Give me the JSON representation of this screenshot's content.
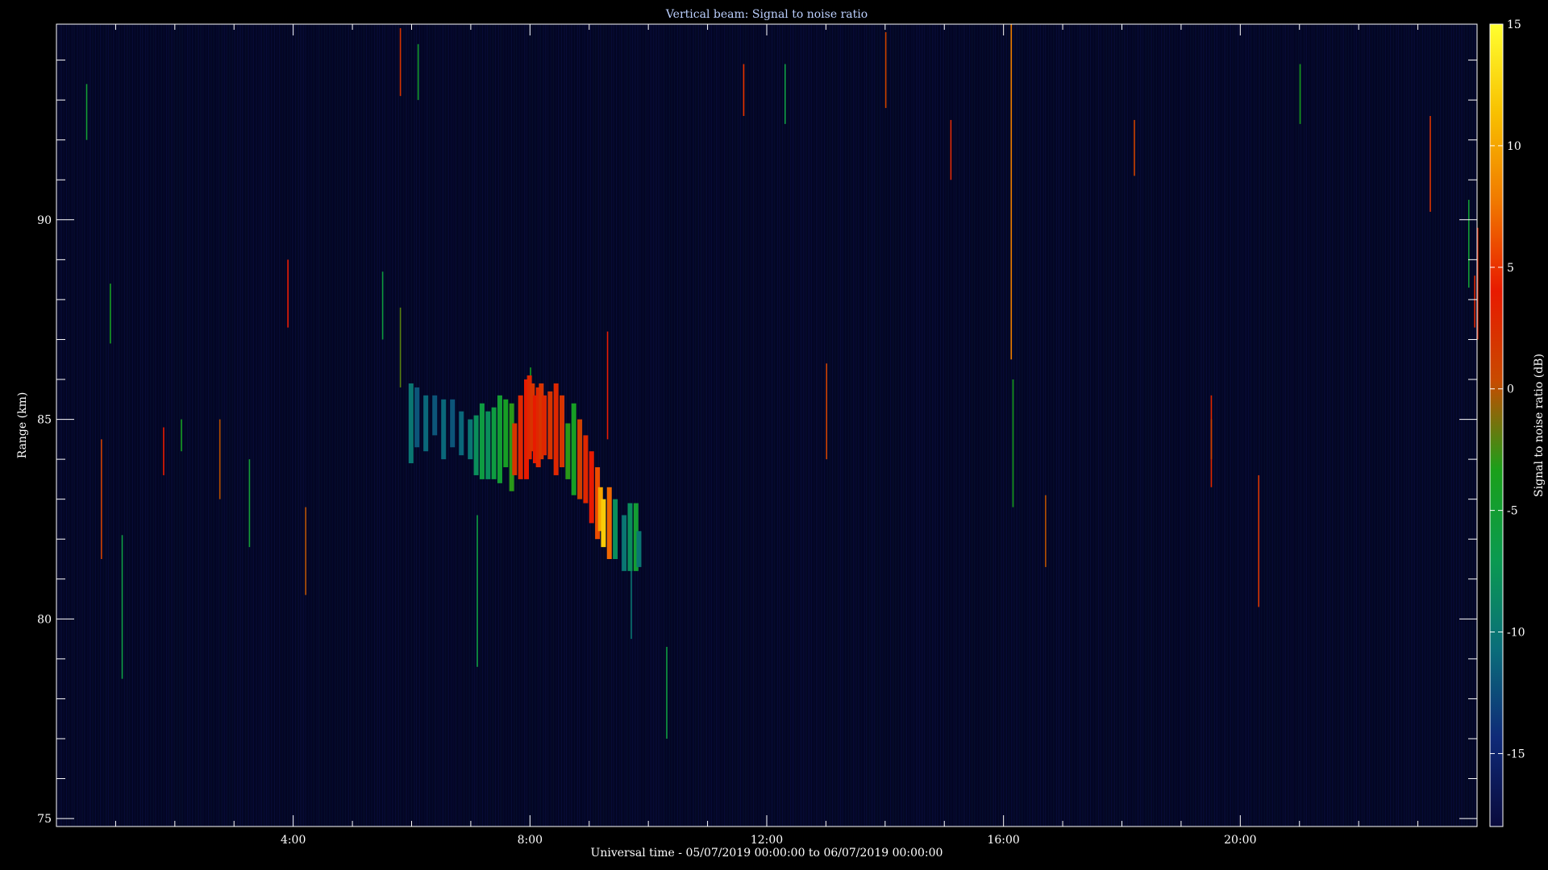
{
  "chart_data": {
    "type": "heatmap",
    "title": "Vertical beam: Signal to noise ratio",
    "xlabel": "Universal time - 05/07/2019 00:00:00 to 06/07/2019 00:00:00",
    "ylabel": "Range (km)",
    "colorbar_label": "Signal to noise ratio (dB)",
    "x_unit": "hours UT",
    "xlim": [
      0,
      24
    ],
    "ylim": [
      74.8,
      94.9
    ],
    "x_ticks": [
      4,
      8,
      12,
      16,
      20
    ],
    "x_tick_labels": [
      "4:00",
      "8:00",
      "12:00",
      "16:00",
      "20:00"
    ],
    "y_ticks": [
      75,
      80,
      85,
      90
    ],
    "y_tick_labels": [
      "75",
      "80",
      "85",
      "90"
    ],
    "colorbar_range": [
      -18,
      15
    ],
    "colorbar_ticks": [
      15,
      10,
      5,
      0,
      -5,
      -10,
      -15
    ],
    "colorbar_tick_labels": [
      "15",
      "10",
      "5",
      "0",
      "-5",
      "-10",
      "-15"
    ],
    "colormap": [
      "#0a0a3c",
      "#0f2a78",
      "#0a6e7a",
      "#0a9a50",
      "#1aa01a",
      "#c84a00",
      "#e81a00",
      "#f07800",
      "#f8c000",
      "#ffff30"
    ],
    "background_color": "#03031e",
    "grid": false,
    "echo_cells": [
      {
        "t": 5.95,
        "r0": 83.9,
        "r1": 85.9,
        "snr": -10
      },
      {
        "t": 6.05,
        "r0": 84.3,
        "r1": 85.8,
        "snr": -12
      },
      {
        "t": 6.2,
        "r0": 84.2,
        "r1": 85.6,
        "snr": -11
      },
      {
        "t": 6.35,
        "r0": 84.6,
        "r1": 85.6,
        "snr": -12
      },
      {
        "t": 6.5,
        "r0": 84.0,
        "r1": 85.5,
        "snr": -11
      },
      {
        "t": 6.65,
        "r0": 84.3,
        "r1": 85.5,
        "snr": -12
      },
      {
        "t": 6.8,
        "r0": 84.1,
        "r1": 85.2,
        "snr": -11
      },
      {
        "t": 6.95,
        "r0": 84.0,
        "r1": 85.0,
        "snr": -10
      },
      {
        "t": 7.05,
        "r0": 83.6,
        "r1": 85.1,
        "snr": -8
      },
      {
        "t": 7.15,
        "r0": 83.5,
        "r1": 85.4,
        "snr": -6
      },
      {
        "t": 7.25,
        "r0": 83.5,
        "r1": 85.2,
        "snr": -8
      },
      {
        "t": 7.35,
        "r0": 83.5,
        "r1": 85.3,
        "snr": -6
      },
      {
        "t": 7.45,
        "r0": 83.4,
        "r1": 85.6,
        "snr": -5
      },
      {
        "t": 7.55,
        "r0": 83.8,
        "r1": 85.5,
        "snr": -4
      },
      {
        "t": 7.65,
        "r0": 83.2,
        "r1": 85.4,
        "snr": -3
      },
      {
        "t": 7.7,
        "r0": 83.6,
        "r1": 84.9,
        "snr": 2
      },
      {
        "t": 7.8,
        "r0": 83.5,
        "r1": 85.6,
        "snr": 3
      },
      {
        "t": 7.9,
        "r0": 83.5,
        "r1": 86.0,
        "snr": 4
      },
      {
        "t": 7.95,
        "r0": 84.0,
        "r1": 86.1,
        "snr": 3
      },
      {
        "t": 8.0,
        "r0": 84.2,
        "r1": 85.9,
        "snr": 2
      },
      {
        "t": 8.05,
        "r0": 83.9,
        "r1": 85.6,
        "snr": 4
      },
      {
        "t": 8.1,
        "r0": 83.8,
        "r1": 85.8,
        "snr": 3
      },
      {
        "t": 8.15,
        "r0": 84.0,
        "r1": 85.9,
        "snr": 2
      },
      {
        "t": 8.2,
        "r0": 84.1,
        "r1": 85.6,
        "snr": 3
      },
      {
        "t": 8.3,
        "r0": 84.0,
        "r1": 85.7,
        "snr": 2
      },
      {
        "t": 8.4,
        "r0": 83.6,
        "r1": 85.9,
        "snr": 3
      },
      {
        "t": 8.5,
        "r0": 83.8,
        "r1": 85.6,
        "snr": 2
      },
      {
        "t": 8.6,
        "r0": 83.5,
        "r1": 84.9,
        "snr": -3
      },
      {
        "t": 8.7,
        "r0": 83.1,
        "r1": 85.4,
        "snr": -4
      },
      {
        "t": 8.8,
        "r0": 83.0,
        "r1": 85.0,
        "snr": 1
      },
      {
        "t": 8.9,
        "r0": 82.9,
        "r1": 84.6,
        "snr": 3
      },
      {
        "t": 9.0,
        "r0": 82.4,
        "r1": 84.2,
        "snr": 4
      },
      {
        "t": 9.1,
        "r0": 82.0,
        "r1": 83.8,
        "snr": 6
      },
      {
        "t": 9.15,
        "r0": 82.2,
        "r1": 83.3,
        "snr": 10
      },
      {
        "t": 9.2,
        "r0": 81.8,
        "r1": 83.0,
        "snr": 12
      },
      {
        "t": 9.3,
        "r0": 81.5,
        "r1": 83.3,
        "snr": 7
      },
      {
        "t": 9.4,
        "r0": 81.5,
        "r1": 83.0,
        "snr": -8
      },
      {
        "t": 9.55,
        "r0": 81.2,
        "r1": 82.6,
        "snr": -10
      },
      {
        "t": 9.65,
        "r0": 81.2,
        "r1": 82.9,
        "snr": -8
      },
      {
        "t": 9.75,
        "r0": 81.2,
        "r1": 82.9,
        "snr": -5
      },
      {
        "t": 9.8,
        "r0": 81.3,
        "r1": 82.2,
        "snr": -10
      }
    ],
    "spikes": [
      {
        "t": 0.5,
        "r0": 92.0,
        "r1": 93.4,
        "snr": -5
      },
      {
        "t": 0.75,
        "r0": 81.5,
        "r1": 84.5,
        "snr": 1
      },
      {
        "t": 0.9,
        "r0": 86.9,
        "r1": 88.4,
        "snr": -4
      },
      {
        "t": 1.1,
        "r0": 78.5,
        "r1": 82.1,
        "snr": -6
      },
      {
        "t": 1.8,
        "r0": 83.6,
        "r1": 84.8,
        "snr": 4
      },
      {
        "t": 2.1,
        "r0": 84.2,
        "r1": 85.0,
        "snr": -4
      },
      {
        "t": 2.75,
        "r0": 83.0,
        "r1": 85.0,
        "snr": 0
      },
      {
        "t": 3.25,
        "r0": 81.8,
        "r1": 84.0,
        "snr": -5
      },
      {
        "t": 3.9,
        "r0": 87.3,
        "r1": 89.0,
        "snr": 4
      },
      {
        "t": 4.2,
        "r0": 80.6,
        "r1": 82.8,
        "snr": 0
      },
      {
        "t": 5.5,
        "r0": 87.0,
        "r1": 88.7,
        "snr": -6
      },
      {
        "t": 5.8,
        "r0": 93.1,
        "r1": 94.8,
        "snr": 2
      },
      {
        "t": 5.8,
        "r0": 85.8,
        "r1": 87.8,
        "snr": -2
      },
      {
        "t": 6.1,
        "r0": 93.0,
        "r1": 94.4,
        "snr": -5
      },
      {
        "t": 7.1,
        "r0": 78.8,
        "r1": 82.6,
        "snr": -6
      },
      {
        "t": 8.0,
        "r0": 84.0,
        "r1": 86.3,
        "snr": -4
      },
      {
        "t": 9.3,
        "r0": 84.5,
        "r1": 87.2,
        "snr": 4
      },
      {
        "t": 9.7,
        "r0": 79.5,
        "r1": 82.3,
        "snr": -10
      },
      {
        "t": 10.3,
        "r0": 77.0,
        "r1": 79.3,
        "snr": -6
      },
      {
        "t": 11.6,
        "r0": 92.6,
        "r1": 93.9,
        "snr": 5
      },
      {
        "t": 12.3,
        "r0": 92.4,
        "r1": 93.9,
        "snr": -6
      },
      {
        "t": 13.0,
        "r0": 84.0,
        "r1": 86.4,
        "snr": 1
      },
      {
        "t": 14.0,
        "r0": 92.8,
        "r1": 94.7,
        "snr": 1
      },
      {
        "t": 15.1,
        "r0": 91.0,
        "r1": 92.5,
        "snr": 3
      },
      {
        "t": 16.12,
        "r0": 86.5,
        "r1": 94.9,
        "snr": 8
      },
      {
        "t": 16.15,
        "r0": 82.8,
        "r1": 86.0,
        "snr": -4
      },
      {
        "t": 16.7,
        "r0": 81.3,
        "r1": 83.1,
        "snr": 0
      },
      {
        "t": 18.2,
        "r0": 91.1,
        "r1": 92.5,
        "snr": 1
      },
      {
        "t": 19.5,
        "r0": 83.3,
        "r1": 85.6,
        "snr": 3
      },
      {
        "t": 19.5,
        "r0": 84.0,
        "r1": 85.0,
        "snr": 1
      },
      {
        "t": 20.3,
        "r0": 80.3,
        "r1": 83.6,
        "snr": 2
      },
      {
        "t": 21.0,
        "r0": 92.4,
        "r1": 93.9,
        "snr": -4
      },
      {
        "t": 23.2,
        "r0": 90.2,
        "r1": 92.6,
        "snr": 2
      },
      {
        "t": 23.95,
        "r0": 87.3,
        "r1": 88.6,
        "snr": 3
      },
      {
        "t": 24.0,
        "r0": 87.0,
        "r1": 89.8,
        "snr": 3
      },
      {
        "t": 23.85,
        "r0": 88.3,
        "r1": 90.5,
        "snr": -5
      }
    ]
  }
}
